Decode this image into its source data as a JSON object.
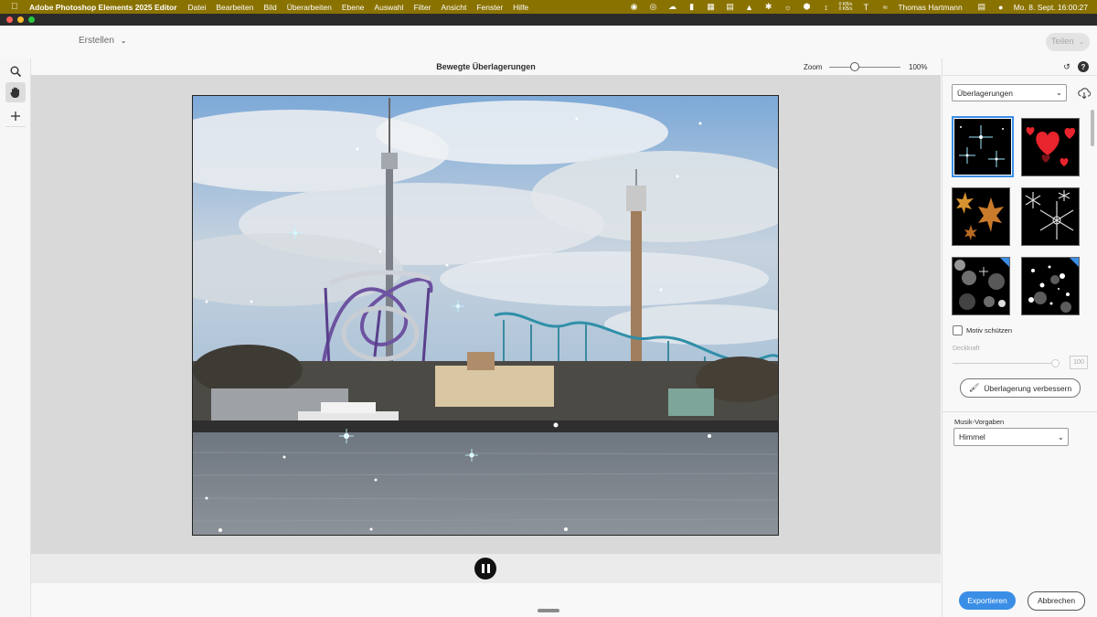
{
  "menubar": {
    "app_name": "Adobe Photoshop Elements 2025 Editor",
    "items": [
      "Datei",
      "Bearbeiten",
      "Bild",
      "Überarbeiten",
      "Ebene",
      "Auswahl",
      "Filter",
      "Ansicht",
      "Fenster",
      "Hilfe"
    ],
    "net_up": "0 KB/s",
    "net_down": "0 KB/s",
    "user": "Thomas Hartmann",
    "datetime": "Mo. 8. Sept.  16:00:27"
  },
  "topbar": {
    "create_label": "Erstellen",
    "share_label": "Teilen"
  },
  "document": {
    "title": "Bewegte Überlagerungen",
    "zoom_label": "Zoom",
    "zoom_value": "100%",
    "zoom_fraction": 0.35
  },
  "panel": {
    "overlay_dropdown": "Überlagerungen",
    "thumbnails": [
      "sparkles",
      "hearts",
      "autumn-leaves",
      "snowflakes",
      "bokeh-circles",
      "snow-bokeh"
    ],
    "protect_subject_label": "Motiv schützen",
    "opacity_label": "Deckkraft",
    "opacity_value": "100",
    "improve_label": "Überlagerung verbessern",
    "music_label": "Musik-Vorgaben",
    "music_value": "Himmel"
  },
  "footer": {
    "export_label": "Exportieren",
    "cancel_label": "Abbrechen"
  },
  "colors": {
    "menubar": "#8a7200",
    "accent": "#3a8ee6",
    "window_close": "#ff5f57",
    "window_minimize": "#febc2e",
    "window_maximize": "#28c840"
  }
}
